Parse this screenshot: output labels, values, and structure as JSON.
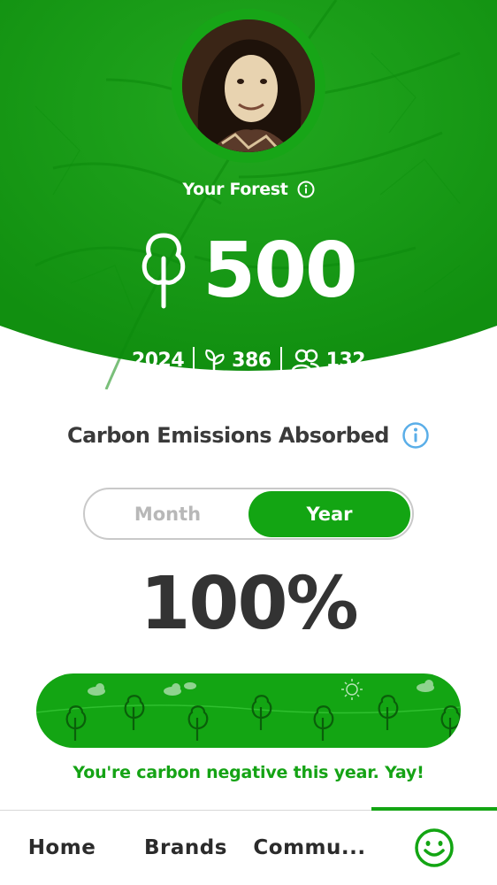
{
  "hero": {
    "title": "Your Forest",
    "tree_count": "500",
    "stats": {
      "year": "2024",
      "sprouts": "386",
      "people": "132"
    }
  },
  "carbon": {
    "title": "Carbon Emissions Absorbed",
    "toggle": {
      "month_label": "Month",
      "year_label": "Year",
      "selected": "Year"
    },
    "percent": "100%",
    "message": "You're carbon negative this year. Yay!"
  },
  "nav": {
    "home": "Home",
    "brands": "Brands",
    "community": "Commu...",
    "active": "forest"
  },
  "colors": {
    "brand_green": "#13a513",
    "info_blue": "#5aaee8",
    "text_dark": "#333333"
  },
  "icons": {
    "info": "info-icon",
    "tree": "tree-icon",
    "sprout": "sprout-icon",
    "people": "people-icon",
    "smiley": "smiley-icon"
  }
}
